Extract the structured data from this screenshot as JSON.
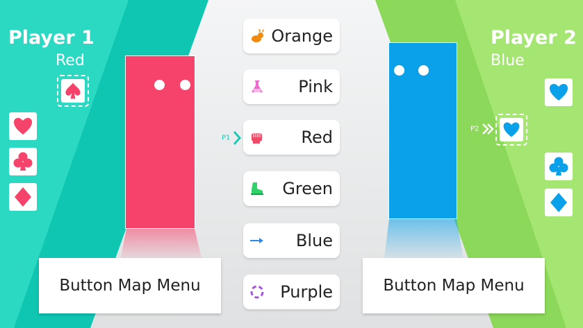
{
  "player1": {
    "title": "Player 1",
    "color_name": "Red",
    "color": "#f6436b",
    "theme": "#1ec7b6",
    "cursor_label": "P1",
    "menu_button": "Button Map Menu",
    "cards": [
      "spade-icon",
      "heart-icon",
      "club-icon",
      "diamond-icon"
    ]
  },
  "player2": {
    "title": "Player 2",
    "color_name": "Blue",
    "color": "#0aa0ea",
    "theme": "#7fd152",
    "cursor_label": "P2",
    "menu_button": "Button Map Menu",
    "cards": [
      "heart-icon",
      "heart-icon",
      "club-icon",
      "diamond-icon"
    ]
  },
  "options": [
    {
      "label": "Orange",
      "icon": "rabbit-icon",
      "icon_color": "#f28a0f"
    },
    {
      "label": "Pink",
      "icon": "flask-icon",
      "icon_color": "#ee6ad0"
    },
    {
      "label": "Red",
      "icon": "fist-icon",
      "icon_color": "#f04a68"
    },
    {
      "label": "Green",
      "icon": "boot-icon",
      "icon_color": "#2fd36a"
    },
    {
      "label": "Blue",
      "icon": "arrow-icon",
      "icon_color": "#2a88e6"
    },
    {
      "label": "Purple",
      "icon": "spiral-icon",
      "icon_color": "#a653e0"
    }
  ]
}
